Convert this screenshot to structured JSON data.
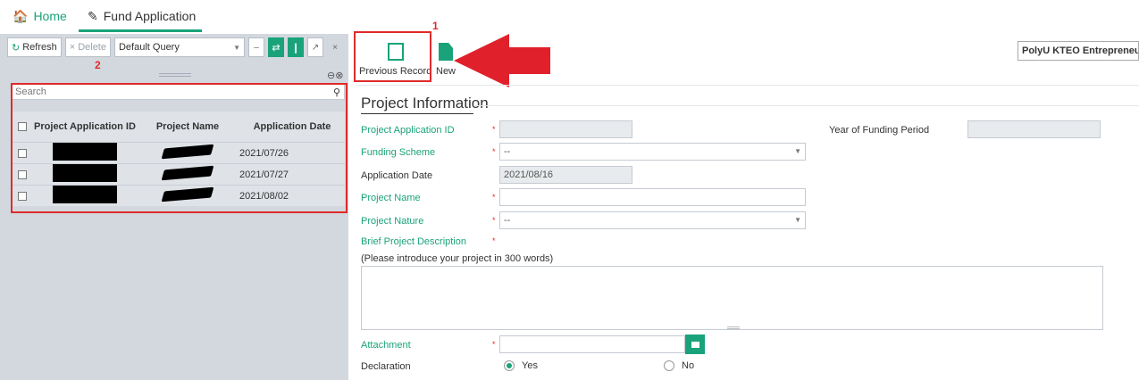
{
  "tabs": {
    "home": "Home",
    "fund": "Fund Application"
  },
  "left_toolbar": {
    "refresh": "Refresh",
    "delete": "Delete",
    "query": "Default Query"
  },
  "annotations": {
    "one": "1",
    "two": "2"
  },
  "search": {
    "placeholder": "Search"
  },
  "grid": {
    "headers": [
      "Project Application ID",
      "Project Name",
      "Application Date"
    ],
    "rows": [
      {
        "date": "2021/07/26"
      },
      {
        "date": "2021/07/27"
      },
      {
        "date": "2021/08/02"
      }
    ]
  },
  "right_toolbar": {
    "previous": "Previous Record",
    "new": "New",
    "org": "PolyU KTEO Entrepreneurs"
  },
  "form": {
    "section": "Project Information",
    "app_id_label": "Project Application ID",
    "year_label": "Year of Funding Period",
    "scheme_label": "Funding Scheme",
    "scheme_value": "--",
    "app_date_label": "Application Date",
    "app_date_value": "2021/08/16",
    "name_label": "Project Name",
    "nature_label": "Project Nature",
    "nature_value": "--",
    "desc_label": "Brief Project Description",
    "desc_hint": "(Please introduce your project in 300 words)",
    "attach_label": "Attachment",
    "decl_label": "Declaration",
    "yes": "Yes",
    "no": "No",
    "required": "*"
  },
  "colors": {
    "accent": "#1aa37a",
    "annotation": "#e02a2a"
  }
}
